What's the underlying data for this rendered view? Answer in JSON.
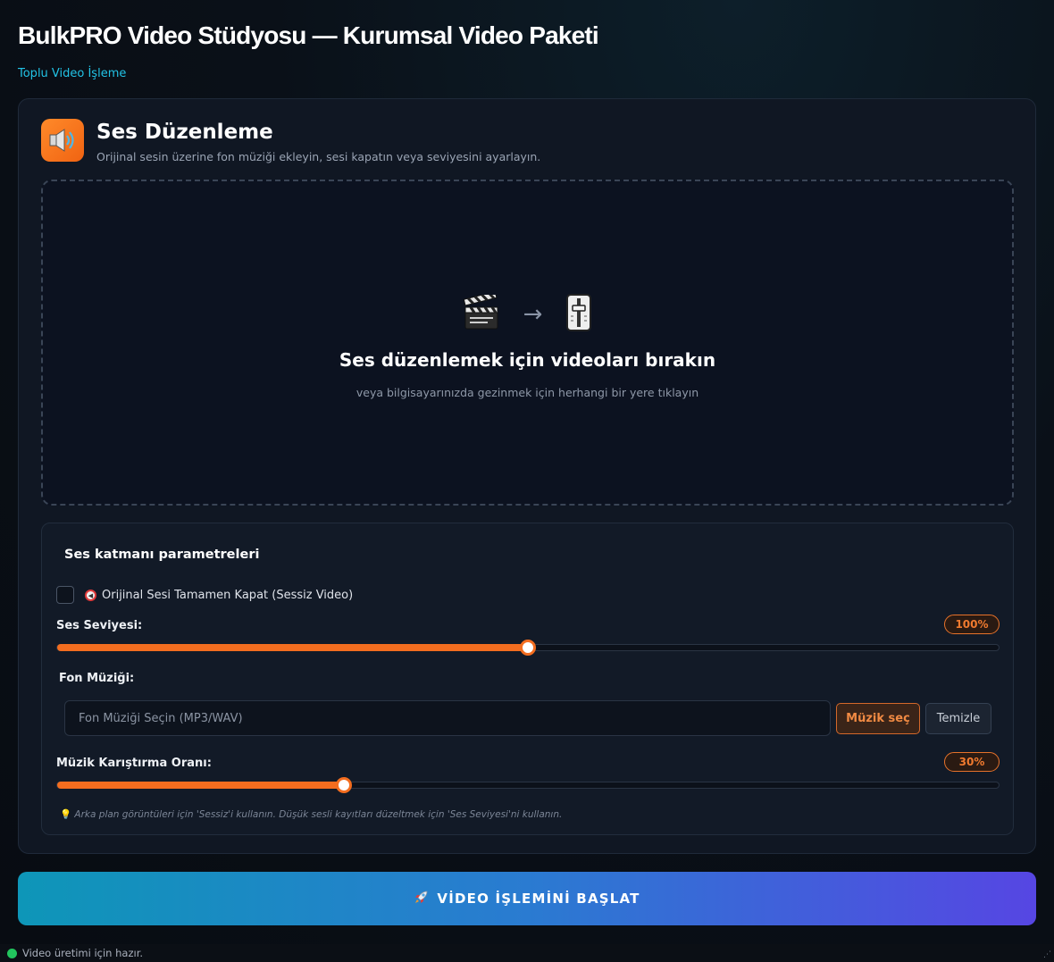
{
  "header": {
    "title": "BulkPRO Video Stüdyosu — Kurumsal Video Paketi",
    "subtitle": "Toplu Video İşleme"
  },
  "section": {
    "icon": "speaker-icon",
    "title": "Ses Düzenleme",
    "description": "Orijinal sesin üzerine fon müziği ekleyin, sesi kapatın veya seviyesini ayarlayın."
  },
  "dropzone": {
    "icon_left": "clapperboard-icon",
    "arrow": "→",
    "icon_right": "level-slider-icon",
    "title": "Ses düzenlemek için videoları bırakın",
    "hint": "veya bilgisayarınızda gezinmek için herhangi bir yere tıklayın"
  },
  "params": {
    "title": "Ses katmanı parametreleri",
    "mute": {
      "checked": false,
      "label": "Orijinal Sesi Tamamen Kapat (Sessiz Video)"
    },
    "volume": {
      "label": "Ses Seviyesi:",
      "value_text": "100%",
      "fraction": 0.5
    },
    "music": {
      "label": "Fon Müziği:",
      "placeholder": "Fon Müziği Seçin (MP3/WAV)",
      "select_label": "Müzik seç",
      "clear_label": "Temizle"
    },
    "mix": {
      "label": "Müzik Karıştırma Oranı:",
      "value_text": "30%",
      "fraction": 0.305
    },
    "tip": "Arka plan görüntüleri için 'Sessiz'i kullanın. Düşük sesli kayıtları düzeltmek için 'Ses Seviyesi'ni kullanın."
  },
  "start_button": {
    "icon": "rocket-icon",
    "label": "VİDEO İŞLEMİNİ BAŞLAT"
  },
  "status_bar": {
    "text": "Video üretimi için hazır.",
    "status_color": "#22c55e"
  },
  "colors": {
    "accent": "#f36d1f",
    "subtitle": "#22c3e6"
  }
}
